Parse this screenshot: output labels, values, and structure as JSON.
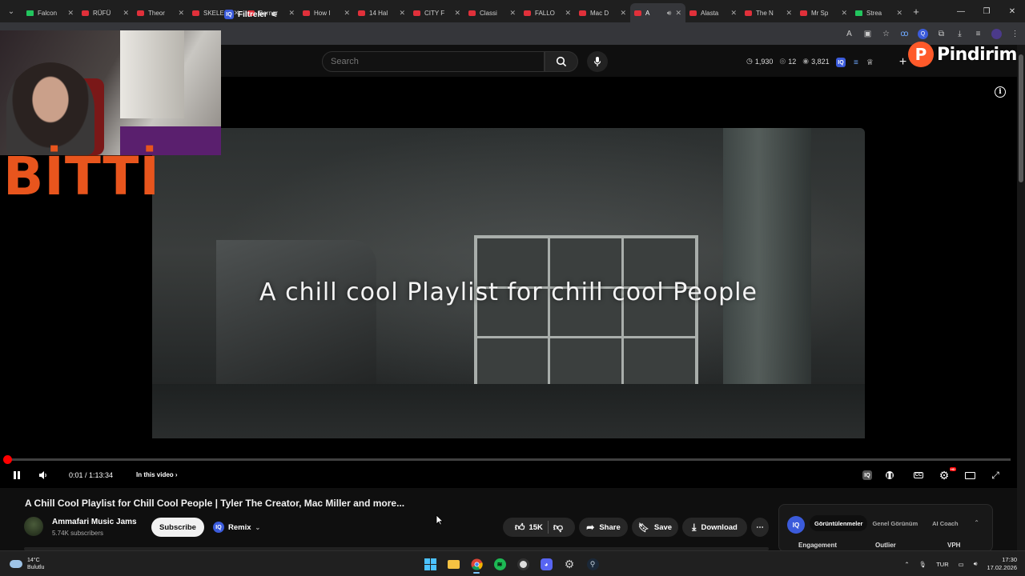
{
  "browser": {
    "tabs": [
      {
        "title": "Falcon",
        "favicon": "green"
      },
      {
        "title": "RÜFÜ",
        "favicon": "red"
      },
      {
        "title": "Theor",
        "favicon": "red"
      },
      {
        "title": "SKELE",
        "favicon": "red"
      },
      {
        "title": "Bernar",
        "favicon": "red"
      },
      {
        "title": "How I",
        "favicon": "red"
      },
      {
        "title": "14 Hal",
        "favicon": "red"
      },
      {
        "title": "CITY F",
        "favicon": "red"
      },
      {
        "title": "Classi",
        "favicon": "red"
      },
      {
        "title": "FALLO",
        "favicon": "red"
      },
      {
        "title": "Mac D",
        "favicon": "red"
      },
      {
        "title": "A",
        "favicon": "red",
        "active": true
      },
      {
        "title": "Alasta",
        "favicon": "red"
      },
      {
        "title": "The N",
        "favicon": "red"
      },
      {
        "title": "Mr Sp",
        "favicon": "red"
      },
      {
        "title": "Strea",
        "favicon": "green"
      }
    ],
    "new_tab": "+"
  },
  "masthead": {
    "filter_label": "Filtreler",
    "iq_label": "IQ",
    "search_placeholder": "Search",
    "stats": {
      "views": "1,930",
      "comments": "12",
      "likes": "3,821"
    }
  },
  "overlay": {
    "pindirim_letter": "P",
    "pindirim_text": "Pindirim",
    "bitti_text": "BİTTİ"
  },
  "player": {
    "caption": "A chill cool Playlist for chill cool People",
    "current_time": "0:01",
    "duration": "1:13:34",
    "time_display": "0:01 / 1:13:34",
    "in_this_video": "In this video",
    "progress_fraction": 0.002,
    "settings_badge": "HD"
  },
  "video": {
    "title": "A Chill Cool Playlist for Chill Cool People | Tyler The Creator, Mac Miller and more...",
    "channel_name": "Ammafari Music Jams",
    "subscribers": "5.74K subscribers",
    "subscribe_label": "Subscribe",
    "remix_label": "Remix",
    "like_count": "15K",
    "share_label": "Share",
    "save_label": "Save",
    "download_label": "Download"
  },
  "iq_panel": {
    "logo": "IQ",
    "tabs": [
      "Görüntülenmeler",
      "Genel Görünüm",
      "AI Coach"
    ],
    "active_tab": "Görüntülenmeler",
    "columns": [
      "Engagement",
      "Outlier",
      "VPH"
    ]
  },
  "taskbar": {
    "weather_temp": "14°C",
    "weather_desc": "Bulutlu",
    "language": "TUR",
    "time": "17:30",
    "date": "17.02.2026"
  },
  "colors": {
    "accent_red": "#ff0000",
    "iq_blue": "#3b5bdb",
    "bitti_orange": "#e8551d",
    "pindirim_orange": "#ff5a2a"
  }
}
